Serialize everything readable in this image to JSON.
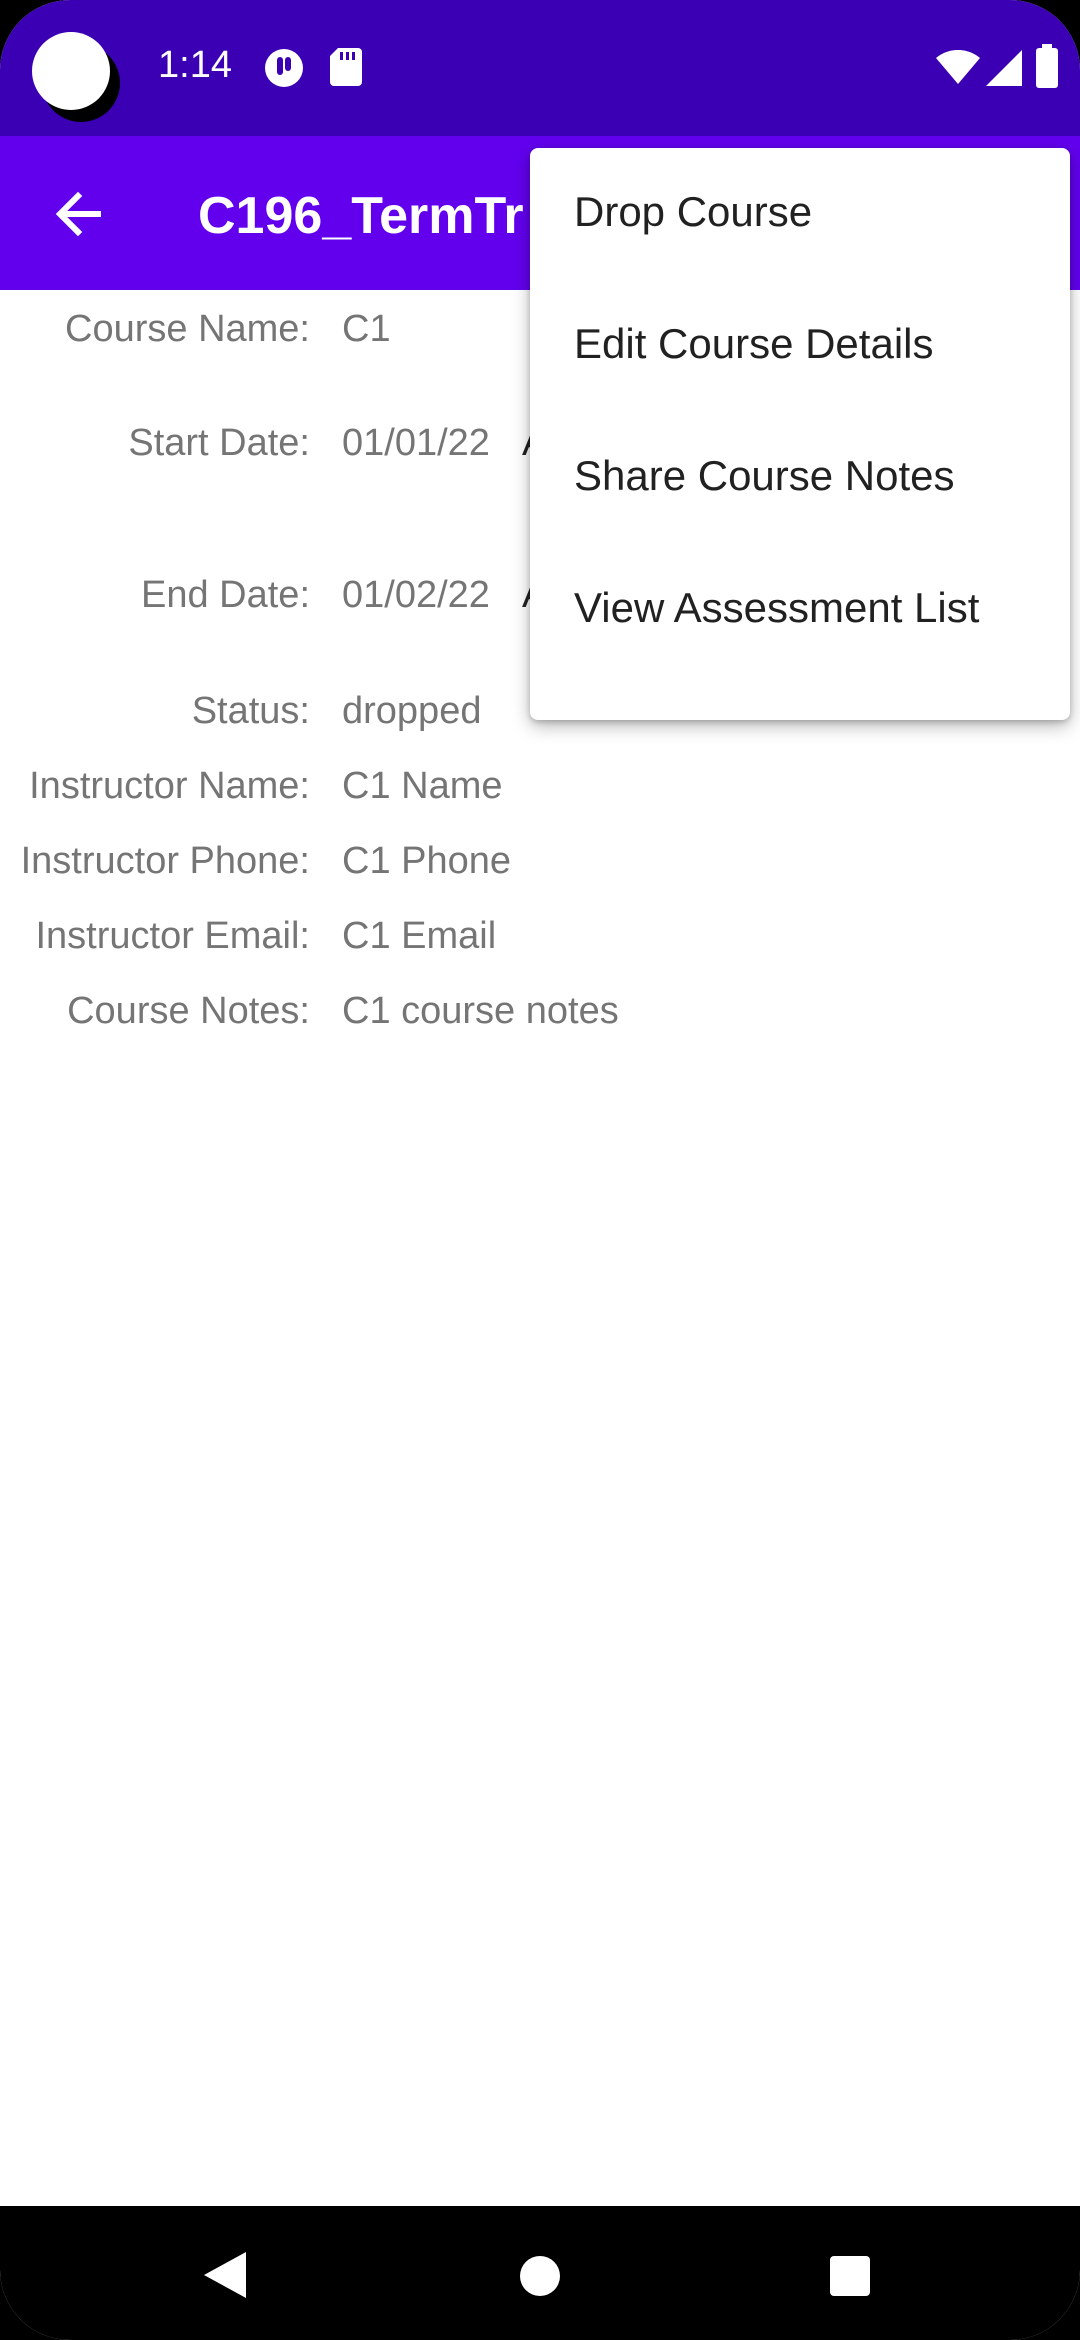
{
  "status_bar": {
    "time": "1:14",
    "left_icons": [
      "camera-cutout",
      "info-badge-icon",
      "sd-card-icon"
    ],
    "right_icons": [
      "wifi-icon",
      "signal-icon",
      "battery-icon"
    ]
  },
  "app_bar": {
    "title": "C196_TermTr",
    "back_icon": "arrow-left-icon",
    "color": "#6200ee"
  },
  "details": {
    "course_name_label": "Course Name:",
    "course_name_value": "C1",
    "start_date_label": "Start Date:",
    "start_date_value": "01/01/22",
    "start_date_extra": "A",
    "end_date_label": "End Date:",
    "end_date_value": "01/02/22",
    "end_date_extra": "A",
    "status_label": "Status:",
    "status_value": "dropped",
    "instructor_name_label": "Instructor Name:",
    "instructor_name_value": "C1 Name",
    "instructor_phone_label": "Instructor Phone:",
    "instructor_phone_value": "C1 Phone",
    "instructor_email_label": "Instructor Email:",
    "instructor_email_value": "C1 Email",
    "course_notes_label": "Course Notes:",
    "course_notes_value": "C1 course notes"
  },
  "menu": {
    "items": [
      {
        "label": "Drop Course"
      },
      {
        "label": "Edit Course Details"
      },
      {
        "label": "Share Course Notes"
      },
      {
        "label": "View Assessment List"
      }
    ]
  },
  "nav_bar": {
    "buttons": [
      "back-triangle-icon",
      "home-circle-icon",
      "recents-square-icon"
    ]
  }
}
